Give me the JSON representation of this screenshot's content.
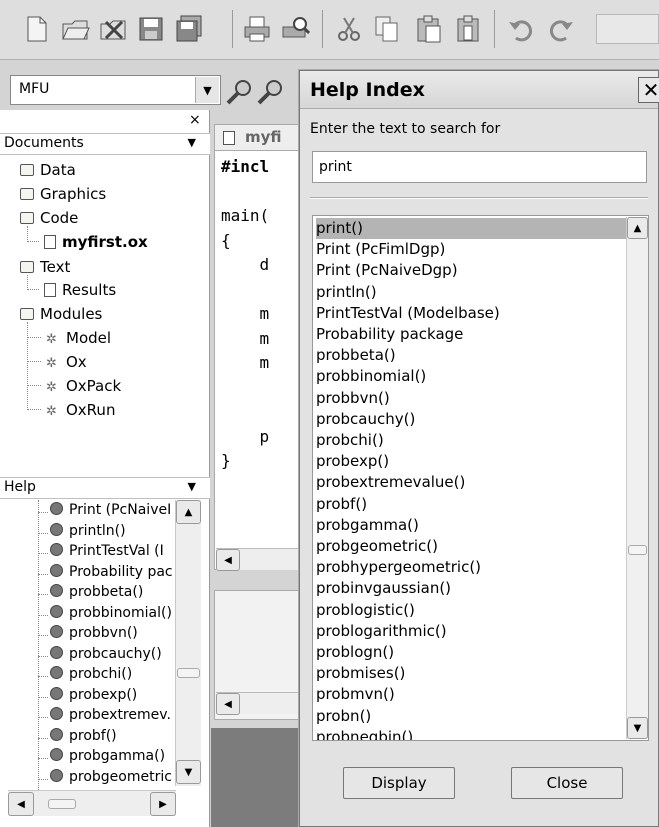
{
  "toolbar": {
    "icons": [
      "new-file-icon",
      "open-file-icon",
      "open-recent-icon",
      "save-icon",
      "save-all-icon",
      "print-icon",
      "print-preview-icon",
      "cut-icon",
      "copy-icon",
      "paste-icon",
      "paste-special-icon",
      "undo-icon",
      "redo-icon"
    ]
  },
  "mfu": {
    "value": "MFU"
  },
  "documents": {
    "header": "Documents",
    "items": [
      {
        "label": "Data",
        "type": "folder"
      },
      {
        "label": "Graphics",
        "type": "folder"
      },
      {
        "label": "Code",
        "type": "folder"
      },
      {
        "label": "myfirst.ox",
        "type": "doc"
      },
      {
        "label": "Text",
        "type": "folder"
      },
      {
        "label": "Results",
        "type": "doc"
      },
      {
        "label": "Modules",
        "type": "folder"
      },
      {
        "label": "Model",
        "type": "gear"
      },
      {
        "label": "Ox",
        "type": "gear"
      },
      {
        "label": "OxPack",
        "type": "gear"
      },
      {
        "label": "OxRun",
        "type": "gear"
      }
    ]
  },
  "help": {
    "header": "Help",
    "items": [
      "Print (PcNaiveI",
      "println()",
      "PrintTestVal (I",
      "Probability pac",
      "probbeta()",
      "probbinomial()",
      "probbvn()",
      "probcauchy()",
      "probchi()",
      "probexp()",
      "probextremev.",
      "probf()",
      "probgamma()",
      "probgeometric"
    ]
  },
  "editor": {
    "tab_label": "myfi",
    "lines": [
      "#incl",
      "",
      "main(",
      "{",
      "    d",
      "",
      "    m",
      "    m",
      "    m",
      "",
      "",
      "    p",
      "}"
    ]
  },
  "dialog": {
    "title": "Help Index",
    "prompt": "Enter the text to search for",
    "search_value": "print",
    "items": [
      "print()",
      "Print (PcFimlDgp)",
      "Print (PcNaiveDgp)",
      "println()",
      "PrintTestVal (Modelbase)",
      "Probability package",
      "probbeta()",
      "probbinomial()",
      "probbvn()",
      "probcauchy()",
      "probchi()",
      "probexp()",
      "probextremevalue()",
      "probf()",
      "probgamma()",
      "probgeometric()",
      "probhypergeometric()",
      "probinvgaussian()",
      "problogistic()",
      "problogarithmic()",
      "problogn()",
      "probmises()",
      "probmvn()",
      "probn()",
      "probnegbin()"
    ],
    "display_label": "Display",
    "close_label": "Close"
  }
}
